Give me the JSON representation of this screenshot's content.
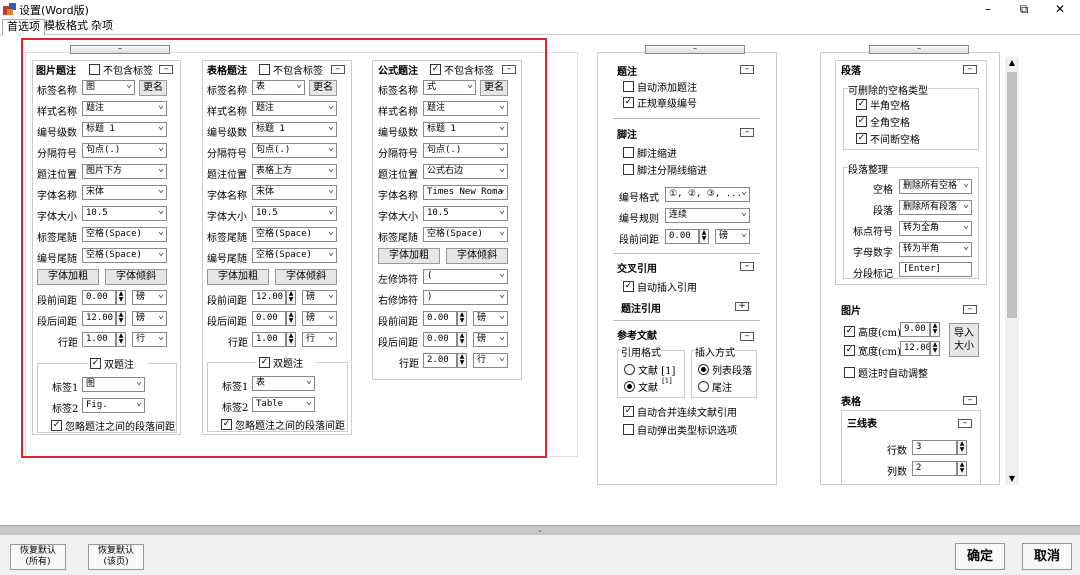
{
  "window": {
    "title": "设置(Word版)",
    "min": "–",
    "max": "⧉",
    "close": "✕"
  },
  "tabs": [
    "首选项",
    "模板格式",
    "杂项"
  ],
  "collapse": "–",
  "fig": {
    "title": "图片题注",
    "exclude": "不包含标签",
    "tag_label": "标签名称",
    "tag_value": "图",
    "rename": "更名",
    "style_label": "样式名称",
    "style_value": "题注",
    "level_label": "编号级数",
    "level_value": "标题 1",
    "sep_label": "分隔符号",
    "sep_value": "句点(.)",
    "pos_label": "题注位置",
    "pos_value": "图片下方",
    "font_label": "字体名称",
    "font_value": "宋体",
    "size_label": "字体大小",
    "size_value": "10.5",
    "tagtail_label": "标签尾随",
    "tagtail_value": "空格(Space)",
    "numtail_label": "编号尾随",
    "numtail_value": "空格(Space)",
    "bold": "字体加粗",
    "italic": "字体倾斜",
    "before_label": "段前间距",
    "before_value": "0.00",
    "before_unit": "磅",
    "after_label": "段后间距",
    "after_value": "12.00",
    "after_unit": "磅",
    "line_label": "行距",
    "line_value": "1.00",
    "line_unit": "行",
    "dual": "双题注",
    "t1_label": "标签1",
    "t1_value": "图",
    "t2_label": "标签2",
    "t2_value": "Fig.",
    "ignore": "忽略题注之间的段落间距"
  },
  "tbl": {
    "title": "表格题注",
    "exclude": "不包含标签",
    "tag_label": "标签名称",
    "tag_value": "表",
    "rename": "更名",
    "style_label": "样式名称",
    "style_value": "题注",
    "level_label": "编号级数",
    "level_value": "标题 1",
    "sep_label": "分隔符号",
    "sep_value": "句点(.)",
    "pos_label": "题注位置",
    "pos_value": "表格上方",
    "font_label": "字体名称",
    "font_value": "宋体",
    "size_label": "字体大小",
    "size_value": "10.5",
    "tagtail_label": "标签尾随",
    "tagtail_value": "空格(Space)",
    "numtail_label": "编号尾随",
    "numtail_value": "空格(Space)",
    "bold": "字体加粗",
    "italic": "字体倾斜",
    "before_label": "段前间距",
    "before_value": "12.00",
    "before_unit": "磅",
    "after_label": "段后间距",
    "after_value": "0.00",
    "after_unit": "磅",
    "line_label": "行距",
    "line_value": "1.00",
    "line_unit": "行",
    "dual": "双题注",
    "t1_label": "标签1",
    "t1_value": "表",
    "t2_label": "标签2",
    "t2_value": "Table",
    "ignore": "忽略题注之间的段落间距"
  },
  "eq": {
    "title": "公式题注",
    "exclude": "不包含标签",
    "tag_label": "标签名称",
    "tag_value": "式",
    "rename": "更名",
    "style_label": "样式名称",
    "style_value": "题注",
    "level_label": "编号级数",
    "level_value": "标题 1",
    "sep_label": "分隔符号",
    "sep_value": "句点(.)",
    "pos_label": "题注位置",
    "pos_value": "公式右边",
    "font_label": "字体名称",
    "font_value": "Times New Roma",
    "size_label": "字体大小",
    "size_value": "10.5",
    "tagtail_label": "标签尾随",
    "tagtail_value": "空格(Space)",
    "bold": "字体加粗",
    "italic": "字体倾斜",
    "lmod_label": "左修饰符",
    "lmod_value": "(",
    "rmod_label": "右修饰符",
    "rmod_value": ")",
    "before_label": "段前间距",
    "before_value": "0.00",
    "before_unit": "磅",
    "after_label": "段后间距",
    "after_value": "0.00",
    "after_unit": "磅",
    "line_label": "行距",
    "line_value": "2.00",
    "line_unit": "行"
  },
  "mid": {
    "caption": {
      "title": "题注",
      "auto_add": "自动添加题注",
      "normalize": "正规章级编号"
    },
    "footnote": {
      "title": "脚注",
      "indent": "脚注缩进",
      "sep_indent": "脚注分隔线缩进",
      "fmt_label": "编号格式",
      "fmt_value": "①, ②, ③, ...",
      "rule_label": "编号规则",
      "rule_value": "连续",
      "before_label": "段前间距",
      "before_value": "0.00",
      "before_unit": "磅"
    },
    "xref": {
      "title": "交叉引用",
      "auto_insert": "自动插入引用",
      "caption_ref": "题注引用",
      "plus": "+"
    },
    "refs": {
      "title": "参考文献",
      "style_title": "引用格式",
      "opt1": "文献 [1]",
      "opt2": "文献",
      "opt2_sup": "[1]",
      "insert_title": "插入方式",
      "ins1": "列表段落",
      "ins2": "尾注",
      "merge": "自动合并连续文献引用",
      "popup": "自动弹出类型标识选项"
    }
  },
  "right": {
    "para": {
      "title": "段落",
      "deletable": "可删除的空格类型",
      "half": "半角空格",
      "full": "全角空格",
      "nbsp": "不间断空格",
      "tidy": "段落整理",
      "space_label": "空格",
      "space_value": "删除所有空格",
      "para_label": "段落",
      "para_value": "删除所有段落",
      "punct_label": "标点符号",
      "punct_value": "转为全角",
      "alnum_label": "字母数字",
      "alnum_value": "转为半角",
      "mark_label": "分段标记",
      "mark_value": "[Enter]"
    },
    "pic": {
      "title": "图片",
      "h_label": "高度(cm)",
      "h_value": "9.00",
      "w_label": "宽度(cm)",
      "w_value": "12.00",
      "import": "导入大小",
      "autofit": "题注时自动调整"
    },
    "table": {
      "title": "表格",
      "three_line": "三线表",
      "rows_label": "行数",
      "rows_value": "3",
      "cols_label": "列数",
      "cols_value": "2"
    }
  },
  "footer": {
    "restore_all": "恢复默认(所有)",
    "restore_page": "恢复默认(该页)",
    "ok": "确定",
    "cancel": "取消"
  }
}
